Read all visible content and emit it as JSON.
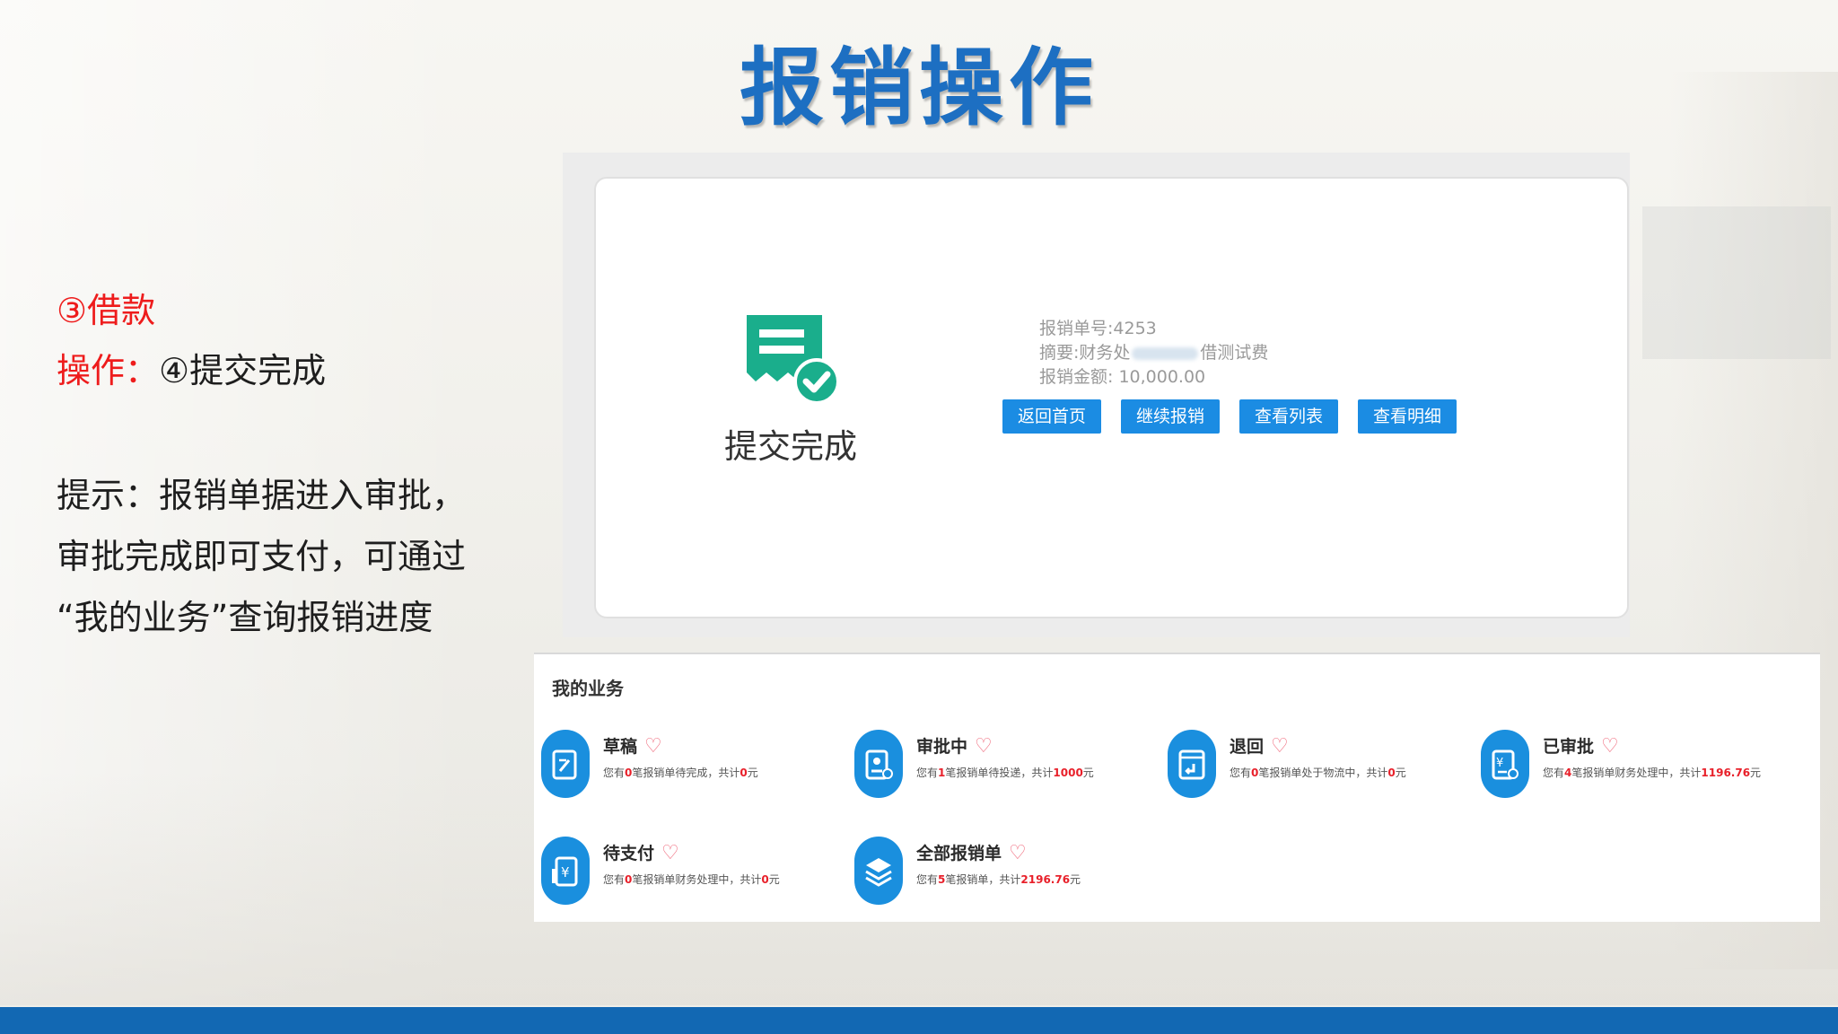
{
  "slide": {
    "title": "报销操作"
  },
  "left_panel": {
    "step": "③借款",
    "op_label": "操作：",
    "op_value": "④提交完成",
    "tip_line1": "提示：报销单据进入审批，",
    "tip_line2": "审批完成即可支付，可通过",
    "tip_line3": "“我的业务”查询报销进度"
  },
  "submit_card": {
    "status_label": "提交完成",
    "bill_no": "报销单号:4253",
    "summary_prefix": "摘要:财务处",
    "summary_suffix": "借测试费",
    "amount": "报销金额: 10,000.00",
    "buttons": {
      "home": "返回首页",
      "continue": "继续报销",
      "list": "查看列表",
      "detail": "查看明细"
    },
    "accent_color": "#1b8ce3",
    "icon_color": "#1aae8c"
  },
  "my_business": {
    "title": "我的业务",
    "items": [
      {
        "name": "草稿",
        "icon": "draft-icon",
        "pre": "您有",
        "n": "0",
        "mid": "笔报销单待完成，共计",
        "sum": "0",
        "unit": "元"
      },
      {
        "name": "审批中",
        "icon": "approving-icon",
        "pre": "您有",
        "n": "1",
        "mid": "笔报销单待投递，共计",
        "sum": "1000",
        "unit": "元"
      },
      {
        "name": "退回",
        "icon": "returned-icon",
        "pre": "您有",
        "n": "0",
        "mid": "笔报销单处于物流中，共计",
        "sum": "0",
        "unit": "元"
      },
      {
        "name": "已审批",
        "icon": "approved-icon",
        "pre": "您有",
        "n": "4",
        "mid": "笔报销单财务处理中，共计",
        "sum": "1196.76",
        "unit": "元"
      },
      {
        "name": "待支付",
        "icon": "pending-pay-icon",
        "pre": "您有",
        "n": "0",
        "mid": "笔报销单财务处理中，共计",
        "sum": "0",
        "unit": "元"
      },
      {
        "name": "全部报销单",
        "icon": "all-bills-icon",
        "pre": "您有",
        "n": "5",
        "mid": "笔报销单，共计",
        "sum": "2196.76",
        "unit": "元"
      }
    ],
    "heart_icon": "heart-outline-icon",
    "highlight_color": "#e8202a",
    "icon_bg": "#1a8fde"
  }
}
